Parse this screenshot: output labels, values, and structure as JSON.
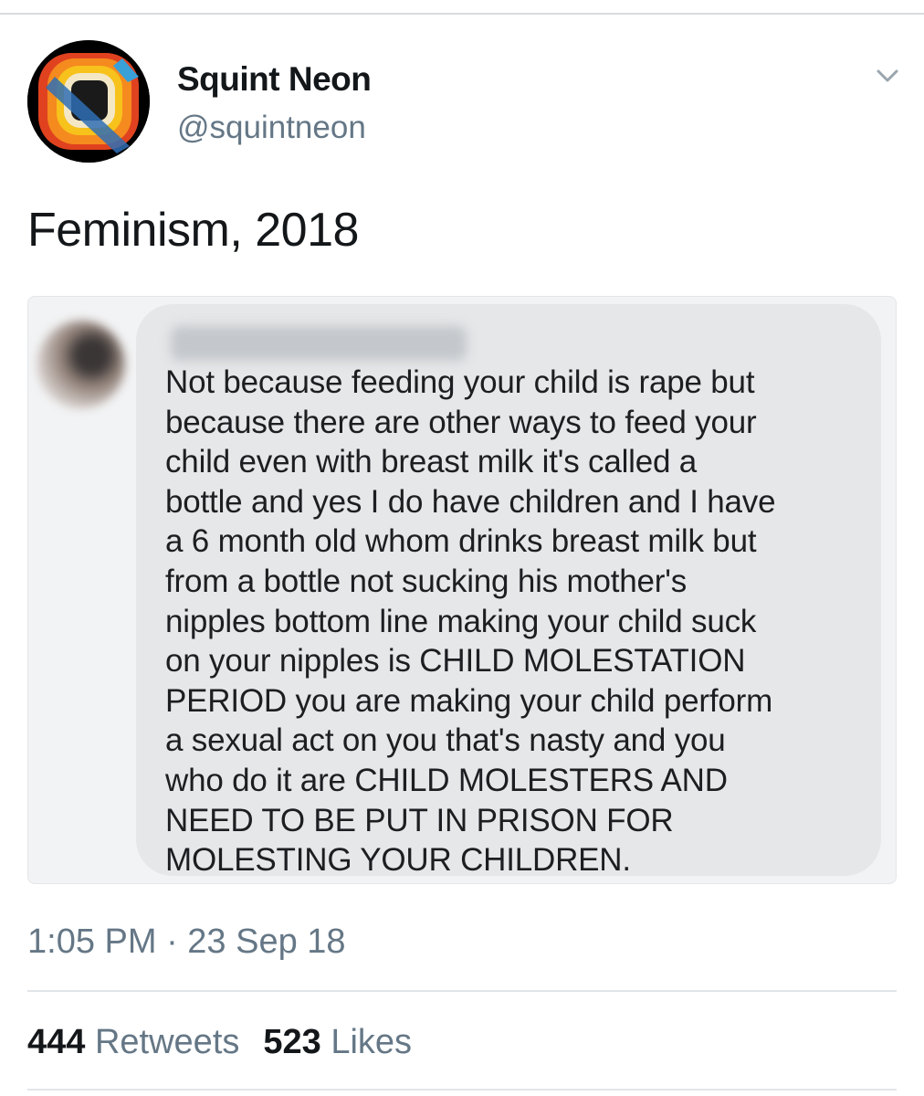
{
  "tweet": {
    "author": {
      "display_name": "Squint Neon",
      "handle": "@squintneon",
      "avatar_icon": "squint-neon-logo"
    },
    "menu_icon": "chevron-down-icon",
    "text": "Feminism, 2018",
    "media": {
      "comment_text": "Not because feeding your child is rape but\nbecause there are other ways to feed your\nchild even with breast milk it's called a\nbottle and yes I do have children and I have\na 6 month old whom drinks breast milk but\nfrom a bottle not sucking his mother's\nnipples bottom line making your child suck\non your nipples is CHILD MOLESTATION\nPERIOD you are making your child perform\na sexual act on you that's nasty and you\nwho do it are CHILD MOLESTERS AND\nNEED TO BE PUT IN PRISON FOR\nMOLESTING YOUR CHILDREN."
    },
    "timestamp": "1:05 PM · 23 Sep 18",
    "stats": {
      "retweets_count": "444",
      "retweets_label": "Retweets",
      "likes_count": "523",
      "likes_label": "Likes"
    }
  },
  "colors": {
    "primary_text": "#14171a",
    "secondary_text": "#657786",
    "divider": "#e1e5e8",
    "bubble": "#e5e7e9"
  }
}
